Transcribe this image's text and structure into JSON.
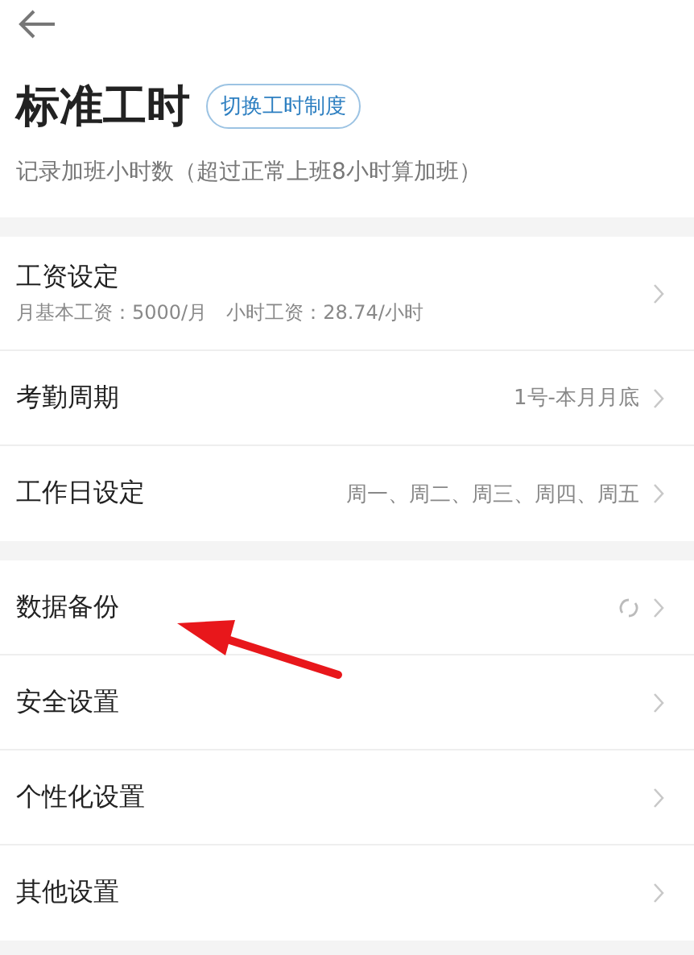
{
  "header": {
    "title": "标准工时",
    "switch_button": "切换工时制度",
    "subtitle": "记录加班小时数（超过正常上班8小时算加班）"
  },
  "groups": [
    {
      "items": [
        {
          "label": "工资设定",
          "detail": "月基本工资：5000/月　小时工资：28.74/小时"
        },
        {
          "label": "考勤周期",
          "value": "1号-本月月底"
        },
        {
          "label": "工作日设定",
          "value": "周一、周二、周三、周四、周五"
        }
      ]
    },
    {
      "items": [
        {
          "label": "数据备份",
          "kind": "sync"
        },
        {
          "label": "安全设置"
        },
        {
          "label": "个性化设置"
        },
        {
          "label": "其他设置"
        }
      ]
    }
  ],
  "annotation": {
    "kind": "arrow"
  }
}
